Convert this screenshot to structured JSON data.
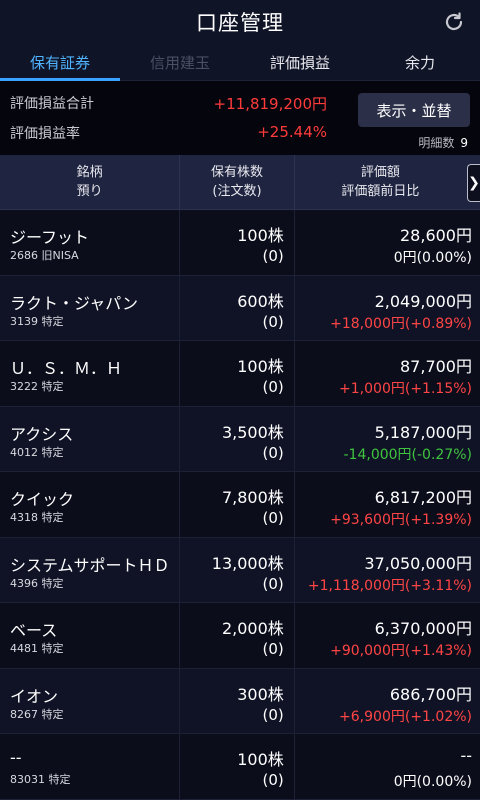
{
  "header": {
    "title": "口座管理"
  },
  "tabs": [
    {
      "label": "保有証券",
      "state": "active"
    },
    {
      "label": "信用建玉",
      "state": "dim"
    },
    {
      "label": "評価損益",
      "state": "normal"
    },
    {
      "label": "余力",
      "state": "normal"
    }
  ],
  "summary": {
    "pl_total_label": "評価損益合計",
    "pl_total_value": "+11,819,200円",
    "pl_rate_label": "評価損益率",
    "pl_rate_value": "+25.44%",
    "sort_button": "表示・並替",
    "count_label": "明細数",
    "count_value": "9"
  },
  "table": {
    "headers": {
      "col1_top": "銘柄",
      "col1_bottom": "預り",
      "col2_top": "保有株数",
      "col2_bottom": "(注文数)",
      "col3_top": "評価額",
      "col3_bottom": "評価額前日比",
      "next_icon": "❯"
    },
    "rows": [
      {
        "name": "ジーフット",
        "code": "2686 旧NISA",
        "qty": "100株",
        "orders": "(0)",
        "value": "28,600円",
        "change": "0円(0.00%)",
        "dir": "flat"
      },
      {
        "name": "ラクト・ジャパン",
        "code": "3139 特定",
        "qty": "600株",
        "orders": "(0)",
        "value": "2,049,000円",
        "change": "+18,000円(+0.89%)",
        "dir": "up"
      },
      {
        "name": "Ｕ．Ｓ．Ｍ．Ｈ",
        "code": "3222 特定",
        "qty": "100株",
        "orders": "(0)",
        "value": "87,700円",
        "change": "+1,000円(+1.15%)",
        "dir": "up"
      },
      {
        "name": "アクシス",
        "code": "4012 特定",
        "qty": "3,500株",
        "orders": "(0)",
        "value": "5,187,000円",
        "change": "-14,000円(-0.27%)",
        "dir": "down"
      },
      {
        "name": "クイック",
        "code": "4318 特定",
        "qty": "7,800株",
        "orders": "(0)",
        "value": "6,817,200円",
        "change": "+93,600円(+1.39%)",
        "dir": "up"
      },
      {
        "name": "システムサポートＨＤ",
        "code": "4396 特定",
        "qty": "13,000株",
        "orders": "(0)",
        "value": "37,050,000円",
        "change": "+1,118,000円(+3.11%)",
        "dir": "up"
      },
      {
        "name": "ベース",
        "code": "4481 特定",
        "qty": "2,000株",
        "orders": "(0)",
        "value": "6,370,000円",
        "change": "+90,000円(+1.43%)",
        "dir": "up"
      },
      {
        "name": "イオン",
        "code": "8267 特定",
        "qty": "300株",
        "orders": "(0)",
        "value": "686,700円",
        "change": "+6,900円(+1.02%)",
        "dir": "up"
      },
      {
        "name": "--",
        "code": "83031 特定",
        "qty": "100株",
        "orders": "(0)",
        "value": "--",
        "change": "0円(0.00%)",
        "dir": "flat"
      }
    ]
  },
  "colors": {
    "up": "#ff4545",
    "down": "#3ec43e",
    "active_tab": "#4fb3ff"
  }
}
